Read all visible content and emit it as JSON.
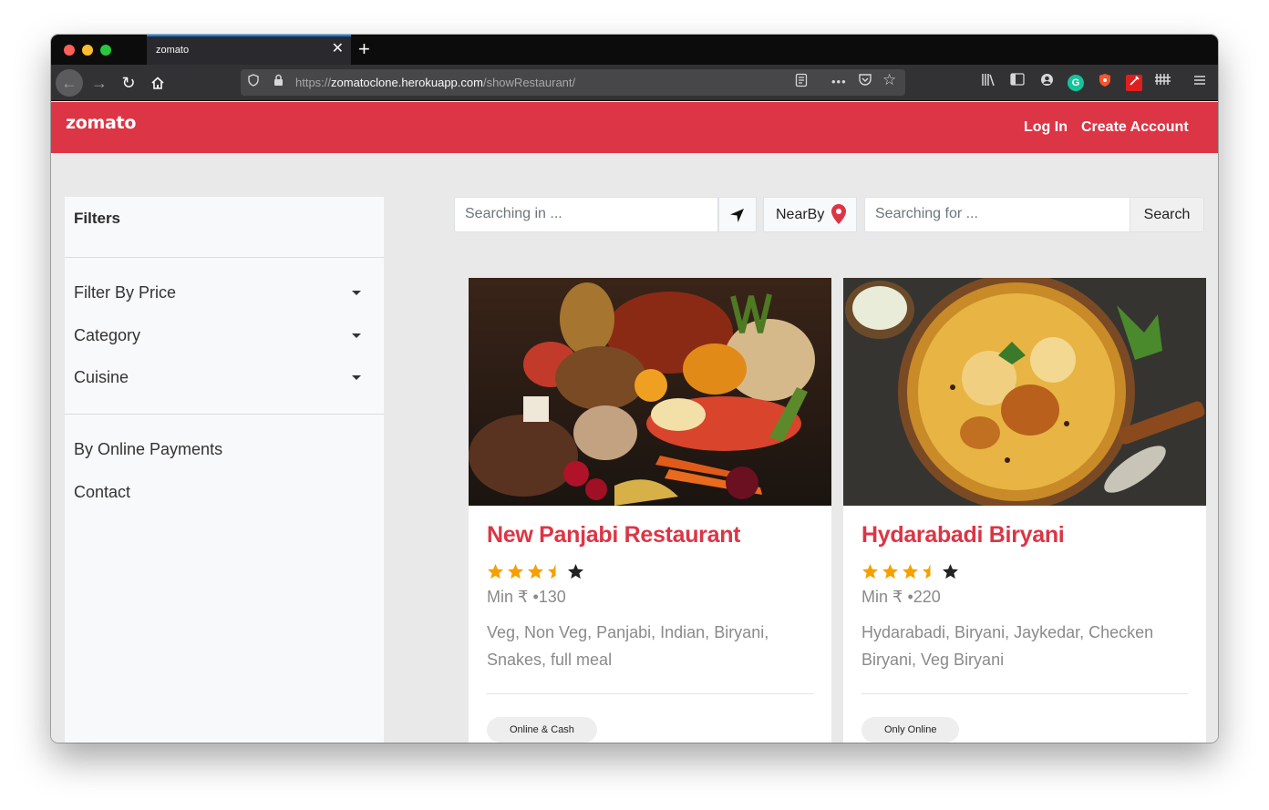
{
  "browser": {
    "tab_title": "zomato",
    "tab_close": "✕",
    "new_tab": "+",
    "url_scheme": "https://",
    "url_host": "zomatoclone.herokuapp.com",
    "url_path": "/showRestaurant/",
    "more_actions": "•••"
  },
  "header": {
    "logo": "zomato",
    "login": "Log In",
    "create_account": "Create Account",
    "brand_color": "#dc3545"
  },
  "sidebar": {
    "title": "Filters",
    "filters": [
      {
        "label": "Filter By Price"
      },
      {
        "label": "Category"
      },
      {
        "label": "Cuisine"
      }
    ],
    "links": [
      {
        "label": "By Online Payments"
      },
      {
        "label": "Contact"
      }
    ]
  },
  "search": {
    "location_placeholder": "Searching in ...",
    "nearby_label": "NearBy",
    "query_placeholder": "Searching for ...",
    "search_button": "Search"
  },
  "restaurants": [
    {
      "name": "New Panjabi Restaurant",
      "rating": 3.5,
      "price": "Min ₹ •130",
      "cuisine": "Veg, Non Veg, Panjabi, Indian, Biryani, Snakes, full meal",
      "payment": "Online & Cash"
    },
    {
      "name": "Hydarabadi Biryani",
      "rating": 3.5,
      "price": "Min ₹ •220",
      "cuisine": "Hydarabadi, Biryani, Jaykedar, Checken Biryani, Veg Biryani",
      "payment": "Only Online"
    }
  ]
}
